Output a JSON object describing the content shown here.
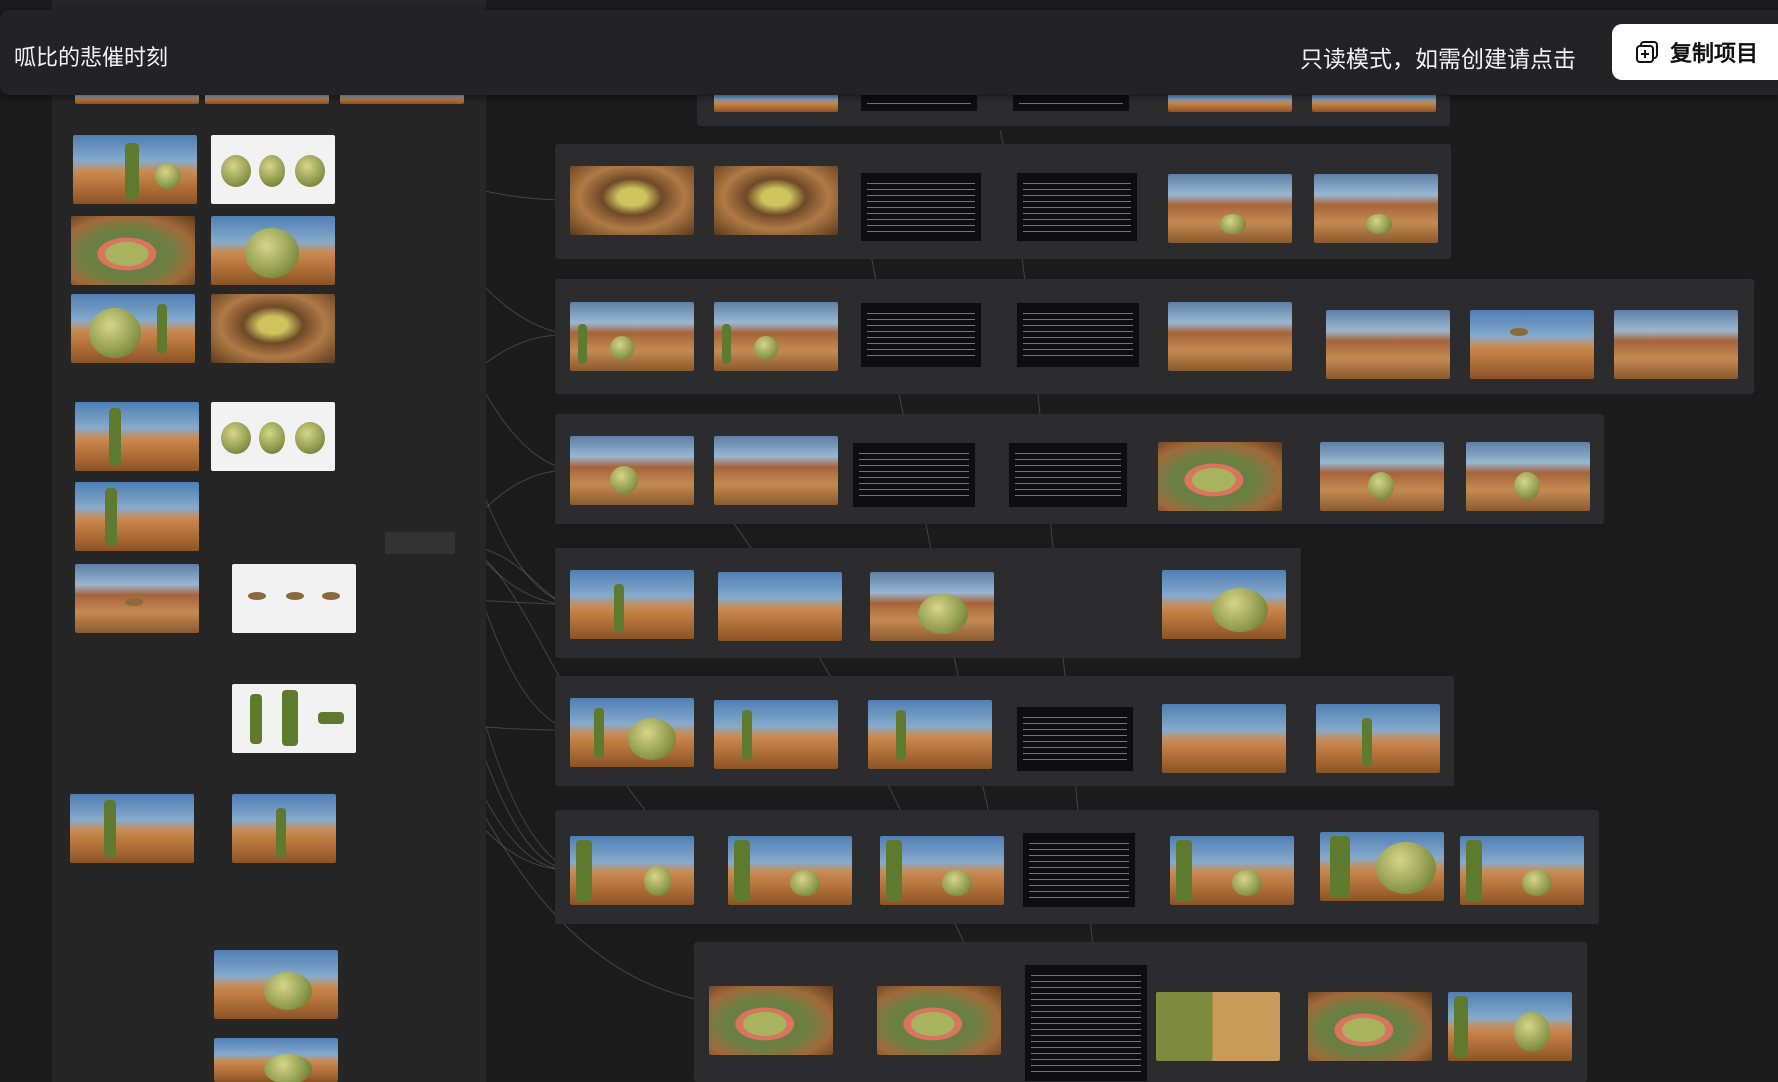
{
  "header": {
    "title": "呱比的悲催时刻",
    "readonly_hint": "只读模式，如需创建请点击",
    "copy_button_label": "复制项目"
  },
  "icons": {
    "copy": "copy-plus-icon"
  },
  "colors": {
    "background": "#1b1b1c",
    "panel": "#262627",
    "group": "#2c2c2e",
    "header": "#232325",
    "button": "#ffffff"
  }
}
